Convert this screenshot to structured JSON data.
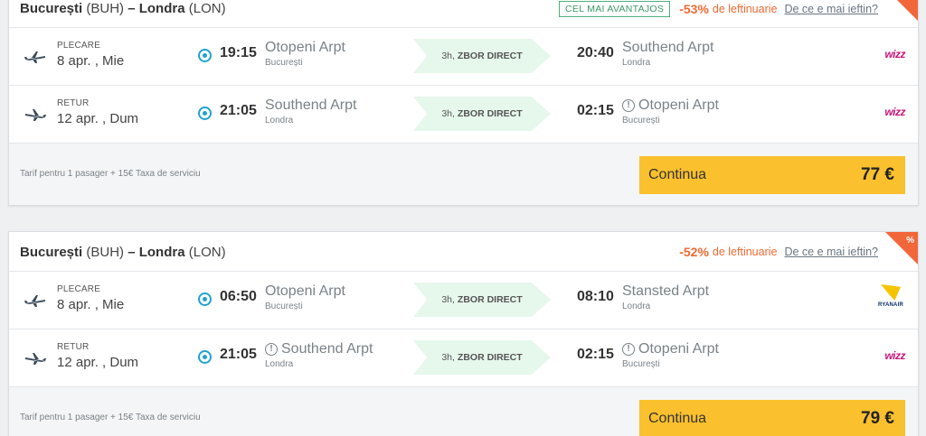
{
  "cards": [
    {
      "route_from": "București",
      "route_from_code": "(BUH)",
      "dash": "–",
      "route_to": "Londra",
      "route_to_code": "(LON)",
      "badge": "CEL MAI AVANTAJOS",
      "percent": "-53%",
      "cheaper": "de leftinuarie",
      "why": "De ce e mai ieftin?",
      "corner_sign": "%",
      "legs": [
        {
          "direction": "PLECARE",
          "date": "8 apr. , Mie",
          "dep_time": "19:15",
          "dep_airport": "Otopeni Arpt",
          "dep_city": "București",
          "duration": "3h,",
          "flight_type": "ZBOR DIRECT",
          "arr_time": "20:40",
          "arr_airport": "Southend Arpt",
          "arr_city": "Londra",
          "airline": "wizz"
        },
        {
          "direction": "RETUR",
          "date": "12 apr. , Dum",
          "dep_time": "21:05",
          "dep_airport": "Southend Arpt",
          "dep_city": "Londra",
          "duration": "3h,",
          "flight_type": "ZBOR DIRECT",
          "arr_time": "02:15",
          "arr_airport": "Otopeni Arpt",
          "arr_city": "București",
          "airline": "wizz"
        }
      ],
      "fare_note": "Tarif pentru 1 pasager + 15€ Taxa de serviciu",
      "continue_label": "Continua",
      "price": "77 €"
    },
    {
      "route_from": "București",
      "route_from_code": "(BUH)",
      "dash": "–",
      "route_to": "Londra",
      "route_to_code": "(LON)",
      "percent": "-52%",
      "cheaper": "de leftinuarie",
      "why": "De ce e mai ieftin?",
      "corner_sign": "%",
      "legs": [
        {
          "direction": "PLECARE",
          "date": "8 apr. , Mie",
          "dep_time": "06:50",
          "dep_airport": "Otopeni Arpt",
          "dep_city": "București",
          "duration": "3h,",
          "flight_type": "ZBOR DIRECT",
          "arr_time": "08:10",
          "arr_airport": "Stansted Arpt",
          "arr_city": "Londra",
          "airline": "RYANAIR"
        },
        {
          "direction": "RETUR",
          "date": "12 apr. , Dum",
          "dep_time": "21:05",
          "dep_airport": "Southend Arpt",
          "dep_city": "Londra",
          "duration": "3h,",
          "flight_type": "ZBOR DIRECT",
          "arr_time": "02:15",
          "arr_airport": "Otopeni Arpt",
          "arr_city": "București",
          "airline": "wizz"
        }
      ],
      "fare_note": "Tarif pentru 1 pasager + 15€ Taxa de serviciu",
      "continue_label": "Continua",
      "price": "79 €"
    }
  ],
  "colors": {
    "accent_orange": "#f06a35",
    "accent_blue": "#1fa3cf",
    "button_yellow": "#fbc02d",
    "badge_green": "#3a9a66",
    "direct_bg": "#e6f7ec",
    "wizz_magenta": "#c8187a"
  },
  "icons": [
    "plane-departure-icon",
    "plane-return-icon",
    "origin-dot-icon",
    "warning-icon",
    "airline-logo"
  ]
}
